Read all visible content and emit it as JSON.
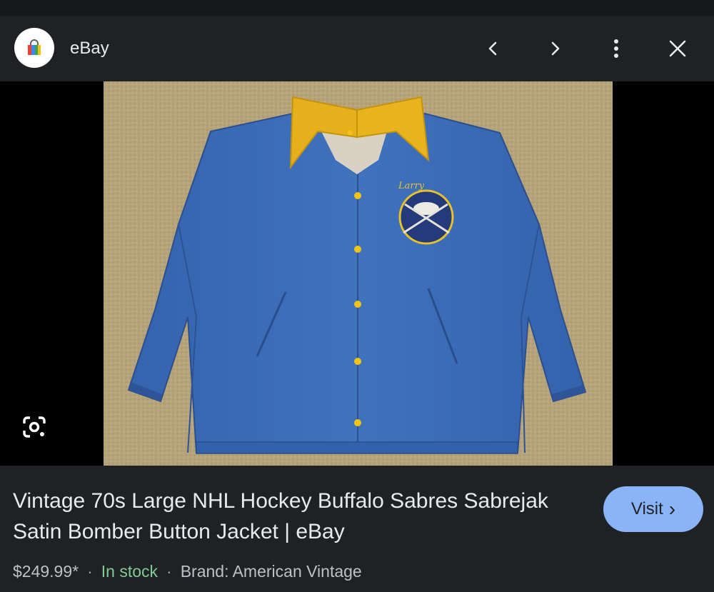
{
  "header": {
    "site_name": "eBay",
    "logo_icon": "shopping-bag-icon",
    "prev_icon": "chevron-left-icon",
    "next_icon": "chevron-right-icon",
    "more_icon": "more-vert-icon",
    "close_icon": "close-icon"
  },
  "image": {
    "lens_icon": "google-lens-icon",
    "patch_text": "Larry"
  },
  "product": {
    "title": "Vintage 70s Large NHL Hockey Buffalo Sabres Sabrejak Satin Bomber Button Jacket | eBay",
    "price": "$249.99*",
    "stock": "In stock",
    "brand": "Brand: American Vintage",
    "separator": "·"
  },
  "visit": {
    "label": "Visit",
    "chevron": "›"
  },
  "colors": {
    "background": "#202124",
    "accent": "#8ab4f8",
    "stock_green": "#81c995",
    "jacket_blue": "#3c6bb5",
    "collar_yellow": "#e8b21a",
    "carpet_tan": "#b9a57c"
  }
}
